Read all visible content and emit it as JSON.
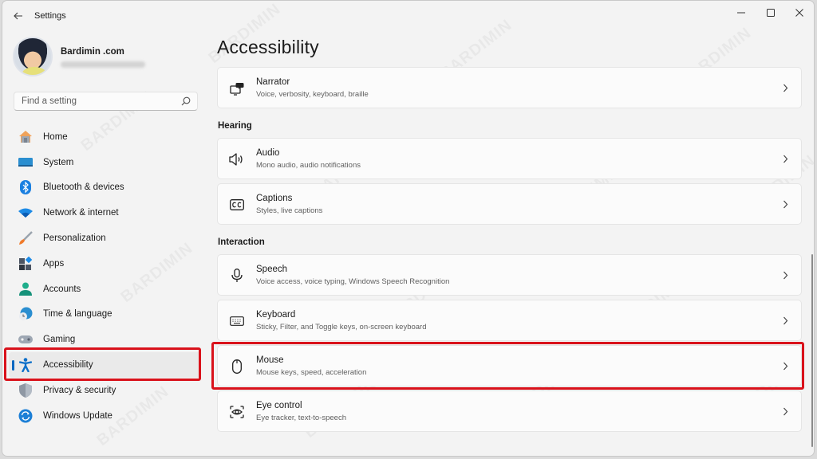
{
  "window": {
    "title": "Settings",
    "back_icon": "arrow-left-icon",
    "controls": {
      "minimize": "minimize-icon",
      "maximize": "maximize-icon",
      "close": "close-icon"
    }
  },
  "profile": {
    "name": "Bardimin .com",
    "email_blurred": true
  },
  "search": {
    "placeholder": "Find a setting",
    "value": "",
    "icon": "search-icon"
  },
  "sidebar": {
    "items": [
      {
        "label": "Home",
        "icon": "home-icon",
        "active": false
      },
      {
        "label": "System",
        "icon": "system-display-icon",
        "active": false
      },
      {
        "label": "Bluetooth & devices",
        "icon": "bluetooth-icon",
        "active": false
      },
      {
        "label": "Network & internet",
        "icon": "wifi-icon",
        "active": false
      },
      {
        "label": "Personalization",
        "icon": "paintbrush-icon",
        "active": false
      },
      {
        "label": "Apps",
        "icon": "apps-icon",
        "active": false
      },
      {
        "label": "Accounts",
        "icon": "person-icon",
        "active": false
      },
      {
        "label": "Time & language",
        "icon": "globe-clock-icon",
        "active": false
      },
      {
        "label": "Gaming",
        "icon": "gamepad-icon",
        "active": false
      },
      {
        "label": "Accessibility",
        "icon": "accessibility-icon",
        "active": true
      },
      {
        "label": "Privacy & security",
        "icon": "shield-icon",
        "active": false
      },
      {
        "label": "Windows Update",
        "icon": "update-sync-icon",
        "active": false
      }
    ]
  },
  "main": {
    "title": "Accessibility",
    "sections": [
      {
        "label": "",
        "cards": [
          {
            "title": "Narrator",
            "subtitle": "Voice, verbosity, keyboard, braille",
            "icon": "narrator-icon"
          }
        ]
      },
      {
        "label": "Hearing",
        "cards": [
          {
            "title": "Audio",
            "subtitle": "Mono audio, audio notifications",
            "icon": "speaker-icon"
          },
          {
            "title": "Captions",
            "subtitle": "Styles, live captions",
            "icon": "closed-captions-icon"
          }
        ]
      },
      {
        "label": "Interaction",
        "cards": [
          {
            "title": "Speech",
            "subtitle": "Voice access, voice typing, Windows Speech Recognition",
            "icon": "microphone-icon"
          },
          {
            "title": "Keyboard",
            "subtitle": "Sticky, Filter, and Toggle keys, on-screen keyboard",
            "icon": "keyboard-icon"
          },
          {
            "title": "Mouse",
            "subtitle": "Mouse keys, speed, acceleration",
            "icon": "mouse-icon",
            "highlighted": true
          },
          {
            "title": "Eye control",
            "subtitle": "Eye tracker, text-to-speech",
            "icon": "eye-control-icon"
          }
        ]
      }
    ]
  },
  "annotations": {
    "highlight_color": "#d9121b",
    "highlighted": [
      "sidebar: Accessibility",
      "card: Mouse"
    ]
  },
  "watermark_text": "BARDIMIN",
  "colors": {
    "accent": "#0067c0",
    "background": "#f3f3f3",
    "card": "#fbfbfb"
  }
}
